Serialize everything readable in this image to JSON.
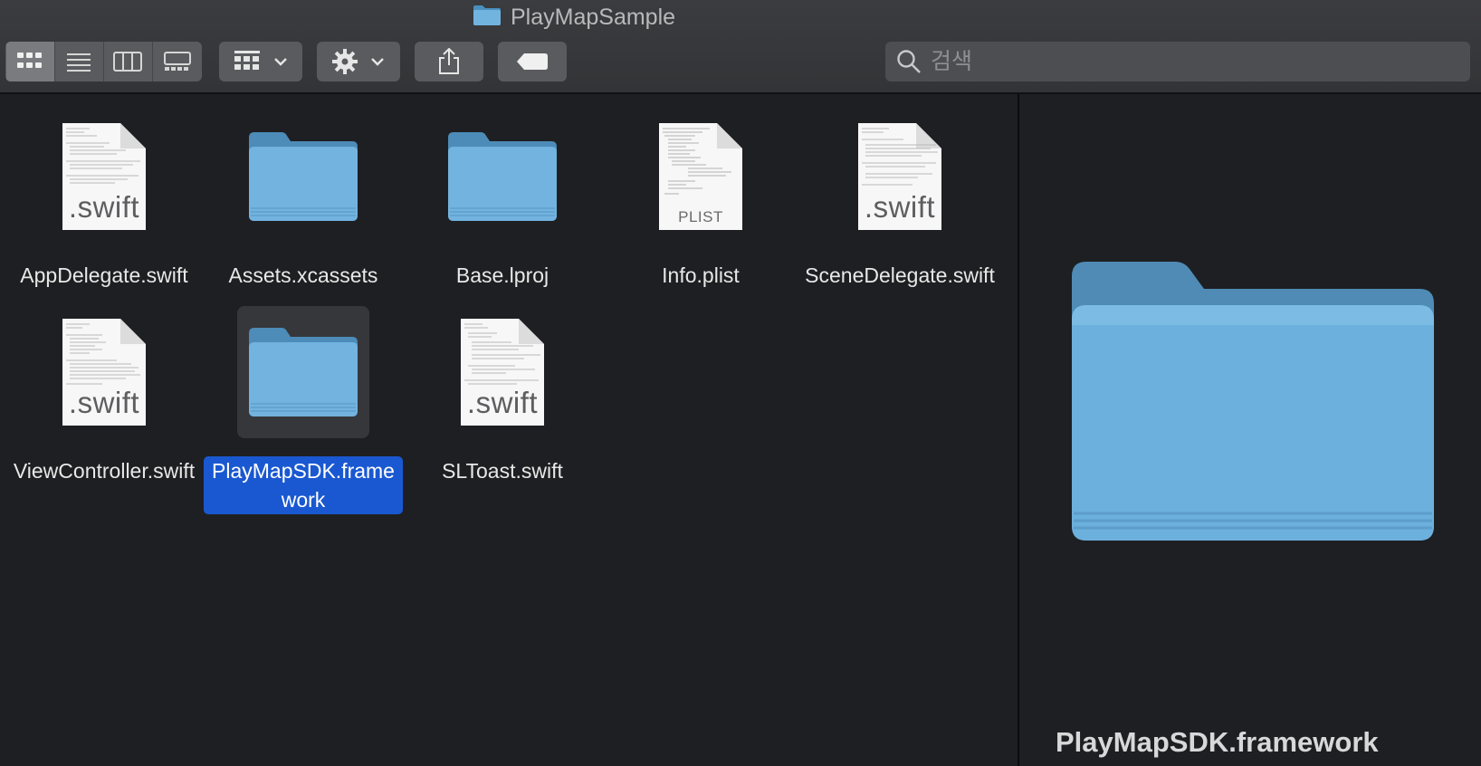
{
  "window": {
    "title": "PlayMapSample"
  },
  "toolbar": {
    "view_modes": [
      "icon-view",
      "list-view",
      "column-view",
      "gallery-view"
    ],
    "selected_view": "icon-view",
    "search": {
      "placeholder": "검색",
      "value": ""
    }
  },
  "files": [
    {
      "name": "AppDelegate.swift",
      "type": "swift",
      "badge": ".swift"
    },
    {
      "name": "Assets.xcassets",
      "type": "folder"
    },
    {
      "name": "Base.lproj",
      "type": "folder"
    },
    {
      "name": "Info.plist",
      "type": "plist",
      "badge": "PLIST"
    },
    {
      "name": "SceneDelegate.swift",
      "type": "swift",
      "badge": ".swift"
    },
    {
      "name": "ViewController.swift",
      "type": "swift",
      "badge": ".swift"
    },
    {
      "name": "PlayMapSDK.framework",
      "type": "folder",
      "selected": true
    },
    {
      "name": "SLToast.swift",
      "type": "swift",
      "badge": ".swift"
    }
  ],
  "preview": {
    "name": "PlayMapSDK.framework"
  },
  "colors": {
    "selection": "#1a58d1",
    "folder": "#6db0dc",
    "background": "#1e1f22"
  }
}
